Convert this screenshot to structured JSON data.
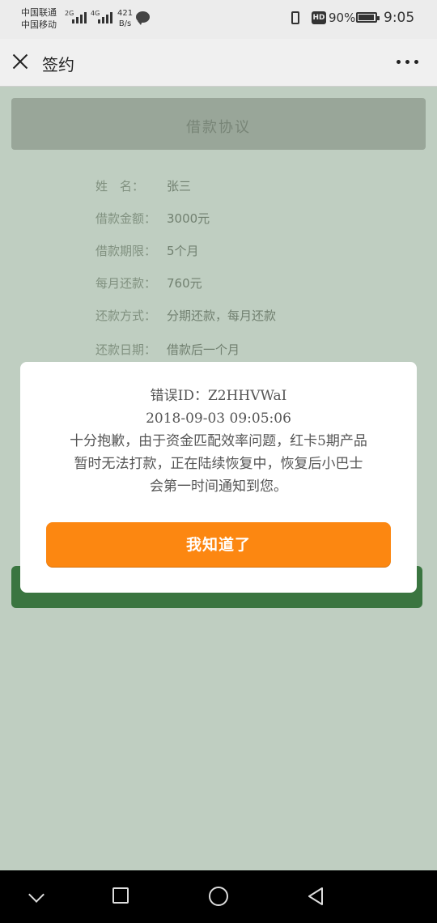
{
  "status_bar": {
    "carrier1": "中国联通",
    "carrier2": "中国移动",
    "signal1_label": "2G",
    "signal2_label": "4G",
    "speed_value": "421",
    "speed_unit": "B/s",
    "battery_percent": "90%",
    "time": "9:05",
    "hd_label": "HD"
  },
  "titlebar": {
    "title": "签约"
  },
  "background_page": {
    "header": "借款协议",
    "rows": [
      {
        "label": "姓　名：",
        "value": "张三"
      },
      {
        "label": "借款金额：",
        "value": "3000元"
      },
      {
        "label": "借款期限：",
        "value": "5个月"
      },
      {
        "label": "每月还款：",
        "value": "760元"
      },
      {
        "label": "还款方式：",
        "value": "分期还款，每月还款"
      },
      {
        "label": "还款日期：",
        "value": "借款后一个月"
      }
    ]
  },
  "modal": {
    "error_id": "错误ID：Z2HHVWaI",
    "timestamp": "2018-09-03  09:05:06",
    "message_line1": "十分抱歉，由于资金匹配效率问题，红卡5期产品",
    "message_line2": "暂时无法打款，正在陆续恢复中，恢复后小巴士",
    "message_line3": "会第一时间通知到您。",
    "button_label": "我知道了"
  },
  "colors": {
    "accent_button": "#fc8711",
    "green_button": "#3f7d45"
  }
}
